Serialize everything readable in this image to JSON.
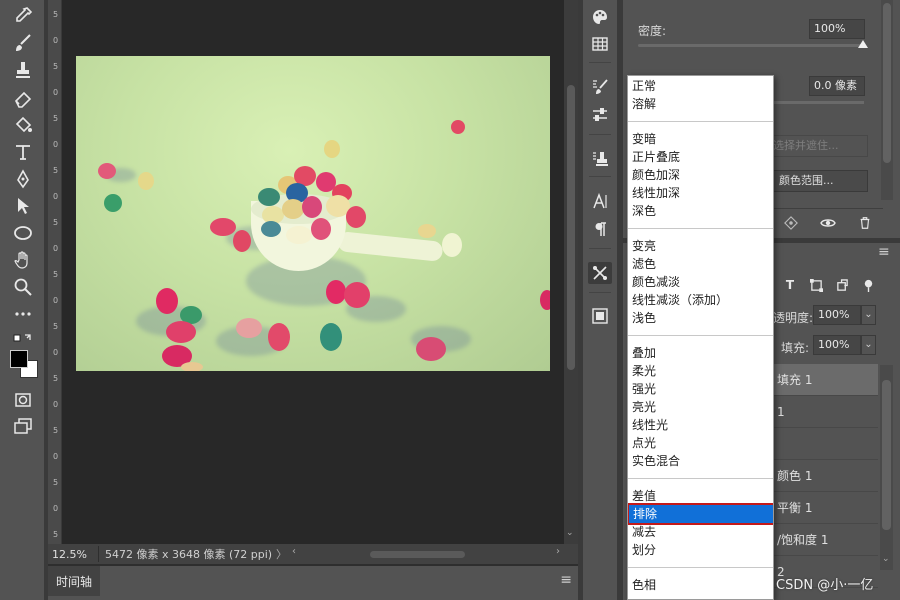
{
  "toolbar": {
    "tools": [
      "eyedropper-icon",
      "brush-icon",
      "clone-stamp-icon",
      "eraser-icon",
      "paint-bucket-icon",
      "type-icon",
      "pen-icon",
      "selection-arrow-icon",
      "ellipse-icon",
      "hand-icon",
      "zoom-icon",
      "more-icon",
      "swap-colors-icon",
      "color-swatches",
      "quick-mask-icon",
      "screen-mode-icon"
    ],
    "foreground_color": "#000000",
    "background_color": "#ffffff"
  },
  "ruler": {
    "labels": [
      "5",
      "0",
      "5",
      "0",
      "5",
      "0",
      "5",
      "0",
      "5",
      "0",
      "5",
      "0",
      "5",
      "0",
      "5",
      "0",
      "5",
      "0",
      "5",
      "0",
      "5"
    ]
  },
  "status": {
    "zoom": "12.5%",
    "doc_info": "5472 像素 x 3648 像素 (72 ppi)",
    "more_arrow": "〉",
    "scroll_left": "‹",
    "scroll_right": "›",
    "scroll_down": "⌄"
  },
  "timeline": {
    "tab_label": "时间轴",
    "menu_icon": "≡"
  },
  "properties": {
    "density_label": "密度:",
    "density_value": "100%",
    "density_level_percent": 100,
    "feather_value": "0.0 像素",
    "select_and_mask_label": "选择并遮住...",
    "color_range_label": "颜色范围..."
  },
  "layers": {
    "menu_icon": "≡",
    "filter_text_icon": "T",
    "opacity_label": "透明度:",
    "opacity_value": "100%",
    "fill_label": "填充:",
    "fill_value": "100%",
    "dropdown_arrow": "⌄",
    "rows": [
      "填充 1",
      "1",
      "",
      "颜色 1",
      "平衡 1",
      "/饱和度 1",
      "2"
    ]
  },
  "blend_menu": {
    "items": [
      "正常",
      "溶解",
      "变暗",
      "正片叠底",
      "颜色加深",
      "线性加深",
      "深色",
      "变亮",
      "滤色",
      "颜色减淡",
      "线性减淡（添加）",
      "浅色",
      "叠加",
      "柔光",
      "强光",
      "亮光",
      "线性光",
      "点光",
      "实色混合",
      "差值",
      "排除",
      "减去",
      "划分",
      "色相"
    ],
    "selected": "排除"
  },
  "watermark": "CSDN @小·一亿",
  "colors": {
    "accent": "#1170d8",
    "highlight_border": "#c41a1a",
    "panel_bg": "#535353",
    "canvas_bg": "#282828"
  }
}
